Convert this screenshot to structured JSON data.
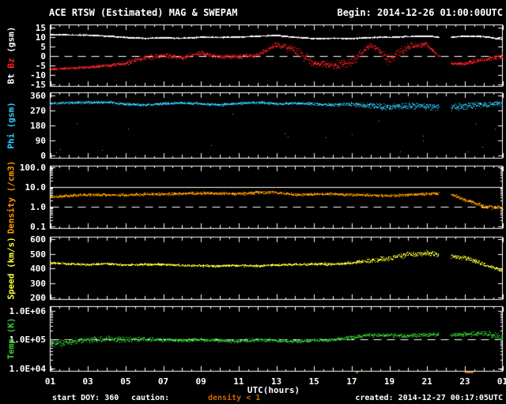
{
  "header": {
    "title": "ACE RTSW (Estimated) MAG & SWEPAM",
    "begin": "Begin: 2014-12-26 01:00:00UTC"
  },
  "footer": {
    "start_doy": "start DOY: 360",
    "caution": "caution:",
    "density_warning": "density < 1",
    "created": "created: 2014-12-27 00:17:05UTC"
  },
  "colors": {
    "background": "#000000",
    "frame": "#ffffff",
    "bt": "#ffffff",
    "bz": "#ff2222",
    "phi": "#33ccff",
    "density": "#ff9900",
    "speed": "#ffff33",
    "temp": "#33cc33",
    "warning_orange": "#cc6600"
  },
  "chart_data": {
    "type": "scatter",
    "title": "ACE RTSW (Estimated) MAG & SWEPAM",
    "begin_time": "2014-12-26 01:00:00UTC",
    "created_time": "2014-12-27 00:17:05UTC",
    "start_doy": 360,
    "x_axis": {
      "label": "UTC(hours)",
      "range_hours": [
        1,
        25
      ],
      "tick_hours": [
        1,
        3,
        5,
        7,
        9,
        11,
        13,
        15,
        17,
        19,
        21,
        23,
        25
      ],
      "tick_labels": [
        "01",
        "03",
        "05",
        "07",
        "09",
        "11",
        "13",
        "15",
        "17",
        "19",
        "21",
        "23",
        "01"
      ]
    },
    "anchor_hours": [
      1,
      2,
      3,
      4,
      5,
      6,
      7,
      8,
      9,
      10,
      11,
      12,
      13,
      14,
      15,
      16,
      17,
      18,
      19,
      20,
      21,
      22,
      23,
      24,
      25
    ],
    "data_gap_hours": [
      21.62,
      22.25
    ],
    "caution_marks_hours": [
      [
        17.2,
        17.35
      ],
      [
        23.0,
        23.45
      ]
    ],
    "panels": [
      {
        "id": "mag",
        "ylabel": "Bt Bz (gsm)",
        "ylabel_parts": [
          {
            "text": "Bt ",
            "color": "#ffffff"
          },
          {
            "text": "Bz",
            "color": "#ff2222"
          },
          {
            "text": " (gsm)",
            "color": "#ffffff"
          }
        ],
        "scale": "linear",
        "ylim": [
          -16,
          16.5
        ],
        "yticks": [
          {
            "v": 15,
            "t": "15"
          },
          {
            "v": 10,
            "t": "10"
          },
          {
            "v": 5,
            "t": "5"
          },
          {
            "v": 0,
            "t": "0"
          },
          {
            "v": -5,
            "t": "-5"
          },
          {
            "v": -10,
            "t": "-10"
          },
          {
            "v": -15,
            "t": "-15"
          }
        ],
        "ref_lines": [
          {
            "value": 0,
            "style": "dashed"
          }
        ],
        "series": [
          {
            "name": "Bt",
            "color": "#ffffff",
            "unit": "nT",
            "values": [
              11.2,
              11.1,
              11.0,
              10.5,
              9.8,
              9.3,
              9.6,
              9.3,
              10.0,
              9.8,
              10.0,
              10.5,
              10.8,
              9.9,
              9.2,
              9.4,
              9.2,
              9.8,
              9.9,
              10.3,
              10.4,
              9.8,
              10.5,
              10.2,
              8.8
            ],
            "noise": 0.3,
            "pts_per_hour": 150
          },
          {
            "name": "Bz",
            "color": "#ff2222",
            "unit": "nT",
            "values": [
              -7,
              -6.5,
              -6,
              -5,
              -4,
              -1,
              0.5,
              -1,
              1.5,
              -0.5,
              -0.5,
              0.5,
              6,
              3,
              -4,
              -5,
              -3,
              6,
              -2,
              5,
              6,
              -4,
              -4,
              -2,
              0
            ],
            "noise": [
              0.6,
              0.6,
              0.7,
              0.8,
              1.2,
              1.8,
              1.5,
              1.5,
              1.5,
              1.2,
              1.2,
              1.5,
              1.5,
              3,
              2.5,
              2.5,
              3,
              2,
              3.5,
              2.5,
              1.5,
              1,
              1,
              1.5,
              1.5
            ],
            "pts_per_hour": 75
          }
        ]
      },
      {
        "id": "phi",
        "ylabel": "Phi (gsm)",
        "ylabel_parts": [
          {
            "text": "Phi (gsm)",
            "color": "#33ccff"
          }
        ],
        "scale": "linear",
        "ylim": [
          0,
          360
        ],
        "yticks": [
          {
            "v": 360,
            "t": "360"
          },
          {
            "v": 270,
            "t": "270"
          },
          {
            "v": 180,
            "t": "180"
          },
          {
            "v": 90,
            "t": "90"
          },
          {
            "v": 0,
            "t": "0"
          }
        ],
        "ref_lines": [],
        "series": [
          {
            "name": "Phi",
            "color": "#33ccff",
            "unit": "deg",
            "values": [
              315,
              318,
              320,
              322,
              310,
              305,
              312,
              318,
              312,
              306,
              315,
              320,
              312,
              316,
              310,
              304,
              310,
              300,
              292,
              300,
              296,
              288,
              298,
              308,
              315
            ],
            "noise": [
              8,
              8,
              9,
              9,
              9,
              8,
              8,
              8,
              8,
              8,
              9,
              9,
              8,
              8,
              9,
              10,
              14,
              20,
              22,
              22,
              24,
              26,
              26,
              22,
              18
            ],
            "pts_per_hour": 75,
            "outliers": {
              "rate": 0.018,
              "range": [
                10,
                255
              ]
            }
          }
        ]
      },
      {
        "id": "density",
        "ylabel": "Density (/cm3)",
        "ylabel_parts": [
          {
            "text": "Density (/cm3)",
            "color": "#ff9900"
          }
        ],
        "scale": "log",
        "ylim": [
          0.1,
          120
        ],
        "yticks": [
          {
            "v": 100,
            "t": "100.0"
          },
          {
            "v": 10,
            "t": "10.0"
          },
          {
            "v": 1,
            "t": "1.0"
          },
          {
            "v": 0.1,
            "t": "0.1"
          }
        ],
        "ref_lines": [
          {
            "value": 10,
            "style": "solid"
          },
          {
            "value": 1,
            "style": "dashed"
          }
        ],
        "series": [
          {
            "name": "Density",
            "color": "#ff9900",
            "unit": "/cm3",
            "values": [
              3.2,
              3.8,
              4.2,
              4.2,
              4.0,
              4.5,
              4.6,
              4.8,
              5.0,
              5.0,
              4.6,
              5.5,
              5.5,
              4.2,
              4.6,
              4.5,
              4.2,
              4.0,
              3.6,
              4.2,
              4.6,
              5.0,
              2.2,
              1.0,
              0.9
            ],
            "noise": [
              0.08,
              0.08,
              0.08,
              0.08,
              0.08,
              0.08,
              0.08,
              0.08,
              0.08,
              0.08,
              0.08,
              0.08,
              0.08,
              0.08,
              0.08,
              0.08,
              0.08,
              0.08,
              0.08,
              0.08,
              0.08,
              0.08,
              0.1,
              0.12,
              0.12
            ],
            "pts_per_hour": 75
          }
        ]
      },
      {
        "id": "speed",
        "ylabel": "Speed (km/s)",
        "ylabel_parts": [
          {
            "text": "Speed (km/s)",
            "color": "#ffff33"
          }
        ],
        "scale": "linear",
        "ylim": [
          200,
          600
        ],
        "yticks": [
          {
            "v": 600,
            "t": "600"
          },
          {
            "v": 500,
            "t": "500"
          },
          {
            "v": 400,
            "t": "400"
          },
          {
            "v": 300,
            "t": "300"
          },
          {
            "v": 200,
            "t": "200"
          }
        ],
        "ref_lines": [],
        "series": [
          {
            "name": "Speed",
            "color": "#ffff33",
            "unit": "km/s",
            "values": [
              440,
              432,
              428,
              435,
              425,
              430,
              428,
              422,
              420,
              418,
              422,
              418,
              425,
              428,
              432,
              430,
              440,
              455,
              470,
              500,
              505,
              490,
              475,
              430,
              385
            ],
            "noise": [
              8,
              8,
              8,
              8,
              8,
              8,
              8,
              8,
              8,
              8,
              8,
              8,
              8,
              8,
              10,
              10,
              12,
              18,
              20,
              22,
              22,
              20,
              18,
              15,
              12
            ],
            "pts_per_hour": 75
          }
        ]
      },
      {
        "id": "temp",
        "ylabel": "Temp (K)",
        "ylabel_parts": [
          {
            "text": "Temp (K)",
            "color": "#33cc33"
          }
        ],
        "scale": "log",
        "ylim": [
          10000,
          1500000
        ],
        "yticks": [
          {
            "v": 1000000,
            "t": "1.0E+06"
          },
          {
            "v": 100000,
            "t": "1.0E+05"
          },
          {
            "v": 10000,
            "t": "1.0E+04"
          }
        ],
        "ref_lines": [
          {
            "value": 100000,
            "style": "dashed"
          }
        ],
        "series": [
          {
            "name": "Temp",
            "color": "#33cc33",
            "unit": "K",
            "values": [
              75000,
              80000,
              100000,
              110000,
              100000,
              105000,
              100000,
              95000,
              100000,
              95000,
              90000,
              100000,
              95000,
              90000,
              95000,
              100000,
              120000,
              150000,
              145000,
              135000,
              150000,
              150000,
              155000,
              170000,
              120000
            ],
            "noise": [
              0.14,
              0.13,
              0.12,
              0.12,
              0.11,
              0.1,
              0.08,
              0.07,
              0.07,
              0.07,
              0.07,
              0.07,
              0.07,
              0.06,
              0.06,
              0.07,
              0.08,
              0.08,
              0.08,
              0.09,
              0.08,
              0.08,
              0.09,
              0.1,
              0.16
            ],
            "pts_per_hour": 75
          }
        ]
      }
    ]
  }
}
